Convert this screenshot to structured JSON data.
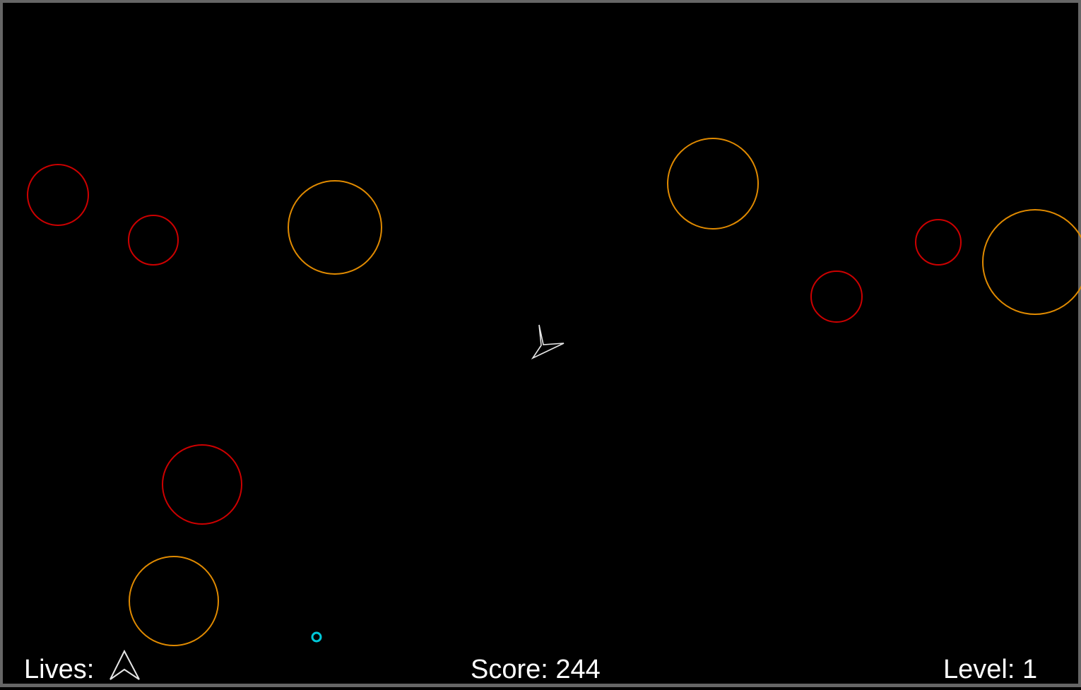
{
  "hud": {
    "lives_label": "Lives:",
    "lives_count": 1,
    "score_text": "Score: 244",
    "level_text": "Level: 1"
  },
  "colors": {
    "background": "#000000",
    "frame": "#666666",
    "text": "#ffffff",
    "ship": "#e6e6e6",
    "asteroid_large": "#e08a00",
    "asteroid_medium": "#cc0000",
    "powerup": "#00c8d8"
  },
  "icons": {
    "ship": "ship-icon",
    "life": "life-ship-icon",
    "asteroid": "asteroid-circle",
    "powerup": "powerup-ring"
  }
}
